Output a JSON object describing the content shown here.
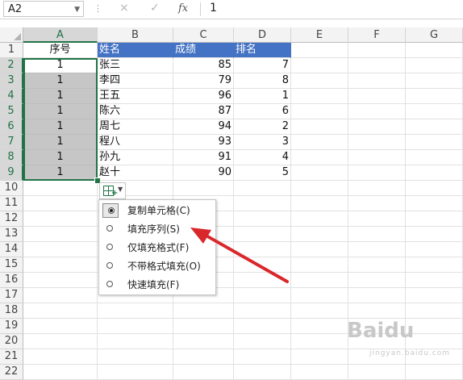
{
  "formula_bar": {
    "name_box": "A2",
    "cancel_icon": "×",
    "confirm_icon": "✓",
    "fx_label": "fx",
    "value": "1"
  },
  "columns": [
    "A",
    "B",
    "C",
    "D",
    "E",
    "F",
    "G"
  ],
  "rows": [
    "1",
    "2",
    "3",
    "4",
    "5",
    "6",
    "7",
    "8",
    "9",
    "10",
    "11",
    "12",
    "13",
    "14",
    "15",
    "16",
    "17",
    "18",
    "19",
    "20",
    "21",
    "22"
  ],
  "table": {
    "headers": [
      "序号",
      "姓名",
      "成绩",
      "排名"
    ],
    "data": [
      [
        "1",
        "张三",
        "85",
        "7"
      ],
      [
        "1",
        "李四",
        "79",
        "8"
      ],
      [
        "1",
        "王五",
        "96",
        "1"
      ],
      [
        "1",
        "陈六",
        "87",
        "6"
      ],
      [
        "1",
        "周七",
        "94",
        "2"
      ],
      [
        "1",
        "程八",
        "93",
        "3"
      ],
      [
        "1",
        "孙九",
        "91",
        "4"
      ],
      [
        "1",
        "赵十",
        "90",
        "5"
      ]
    ]
  },
  "autofill_menu": {
    "items": [
      {
        "label": "复制单元格(C)",
        "selected": true
      },
      {
        "label": "填充序列(S)",
        "selected": false
      },
      {
        "label": "仅填充格式(F)",
        "selected": false
      },
      {
        "label": "不带格式填充(O)",
        "selected": false
      },
      {
        "label": "快速填充(F)",
        "selected": false
      }
    ]
  },
  "colors": {
    "header_fill": "#4472c4",
    "selection": "#217346",
    "arrow": "#d9282b"
  },
  "watermark": {
    "text": "Baidu",
    "sub": "jingyan.baidu.com"
  }
}
